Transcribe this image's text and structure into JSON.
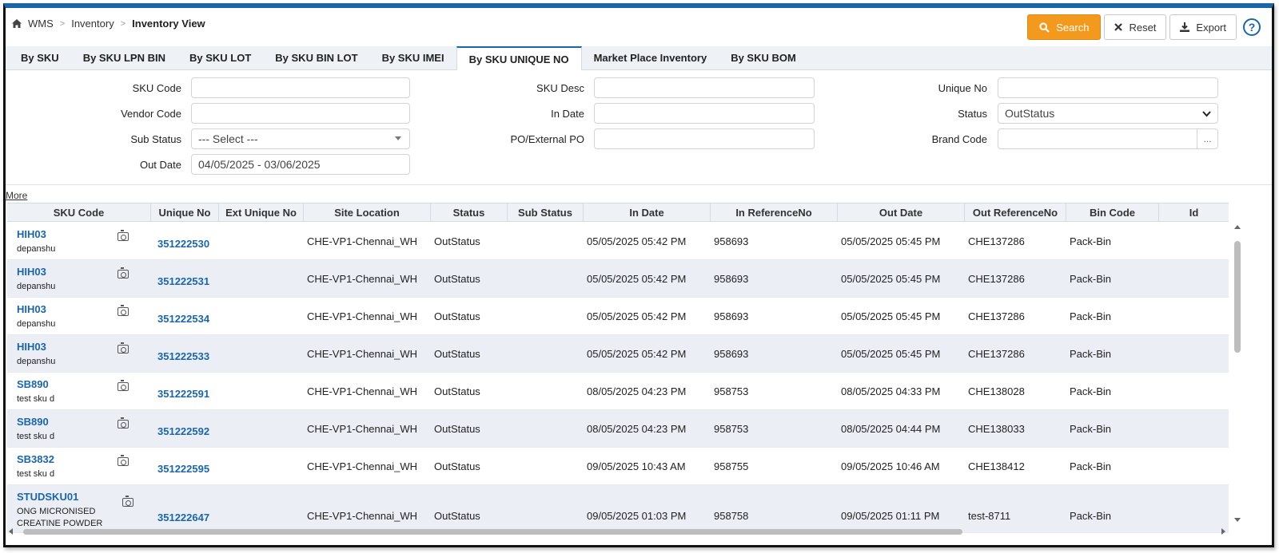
{
  "breadcrumb": {
    "home_icon": "home-icon",
    "items": [
      "WMS",
      "Inventory",
      "Inventory View"
    ],
    "separator": ">"
  },
  "toolbar": {
    "search_label": "Search",
    "reset_label": "Reset",
    "export_label": "Export",
    "help_label": "?",
    "accent_color": "#f39a1e"
  },
  "tabs": [
    {
      "label": "By SKU",
      "active": false
    },
    {
      "label": "By SKU LPN BIN",
      "active": false
    },
    {
      "label": "By SKU LOT",
      "active": false
    },
    {
      "label": "By SKU BIN LOT",
      "active": false
    },
    {
      "label": "By SKU IMEI",
      "active": false
    },
    {
      "label": "By SKU UNIQUE NO",
      "active": true
    },
    {
      "label": "Market Place Inventory",
      "active": false
    },
    {
      "label": "By SKU BOM",
      "active": false
    }
  ],
  "filters": {
    "sku_code": {
      "label": "SKU Code",
      "value": ""
    },
    "sku_desc": {
      "label": "SKU Desc",
      "value": ""
    },
    "unique_no": {
      "label": "Unique No",
      "value": ""
    },
    "vendor_code": {
      "label": "Vendor Code",
      "value": ""
    },
    "in_date": {
      "label": "In Date",
      "value": ""
    },
    "status": {
      "label": "Status",
      "value": "OutStatus"
    },
    "sub_status": {
      "label": "Sub Status",
      "value": "--- Select ---"
    },
    "po_external": {
      "label": "PO/External PO",
      "value": ""
    },
    "brand_code": {
      "label": "Brand Code",
      "value": "",
      "lookup": "..."
    },
    "out_date": {
      "label": "Out Date",
      "value": "04/05/2025 - 03/06/2025"
    }
  },
  "more_link": "More",
  "grid": {
    "columns": [
      "SKU Code",
      "Unique No",
      "Ext Unique No",
      "Site Location",
      "Status",
      "Sub Status",
      "In Date",
      "In ReferenceNo",
      "Out Date",
      "Out ReferenceNo",
      "Bin Code",
      "Id"
    ],
    "rows": [
      {
        "sku_code": "HIH03",
        "sku_desc": "depanshu",
        "unique_no": "351222530",
        "ext_unique_no": "",
        "site_location": "CHE-VP1-Chennai_WH",
        "status": "OutStatus",
        "sub_status": "",
        "in_date": "05/05/2025 05:42 PM",
        "in_ref": "958693",
        "out_date": "05/05/2025 05:45 PM",
        "out_ref": "CHE137286",
        "bin_code": "Pack-Bin",
        "id": ""
      },
      {
        "sku_code": "HIH03",
        "sku_desc": "depanshu",
        "unique_no": "351222531",
        "ext_unique_no": "",
        "site_location": "CHE-VP1-Chennai_WH",
        "status": "OutStatus",
        "sub_status": "",
        "in_date": "05/05/2025 05:42 PM",
        "in_ref": "958693",
        "out_date": "05/05/2025 05:45 PM",
        "out_ref": "CHE137286",
        "bin_code": "Pack-Bin",
        "id": ""
      },
      {
        "sku_code": "HIH03",
        "sku_desc": "depanshu",
        "unique_no": "351222534",
        "ext_unique_no": "",
        "site_location": "CHE-VP1-Chennai_WH",
        "status": "OutStatus",
        "sub_status": "",
        "in_date": "05/05/2025 05:42 PM",
        "in_ref": "958693",
        "out_date": "05/05/2025 05:45 PM",
        "out_ref": "CHE137286",
        "bin_code": "Pack-Bin",
        "id": ""
      },
      {
        "sku_code": "HIH03",
        "sku_desc": "depanshu",
        "unique_no": "351222533",
        "ext_unique_no": "",
        "site_location": "CHE-VP1-Chennai_WH",
        "status": "OutStatus",
        "sub_status": "",
        "in_date": "05/05/2025 05:42 PM",
        "in_ref": "958693",
        "out_date": "05/05/2025 05:45 PM",
        "out_ref": "CHE137286",
        "bin_code": "Pack-Bin",
        "id": ""
      },
      {
        "sku_code": "SB890",
        "sku_desc": "test sku d",
        "unique_no": "351222591",
        "ext_unique_no": "",
        "site_location": "CHE-VP1-Chennai_WH",
        "status": "OutStatus",
        "sub_status": "",
        "in_date": "08/05/2025 04:23 PM",
        "in_ref": "958753",
        "out_date": "08/05/2025 04:33 PM",
        "out_ref": "CHE138028",
        "bin_code": "Pack-Bin",
        "id": ""
      },
      {
        "sku_code": "SB890",
        "sku_desc": "test sku d",
        "unique_no": "351222592",
        "ext_unique_no": "",
        "site_location": "CHE-VP1-Chennai_WH",
        "status": "OutStatus",
        "sub_status": "",
        "in_date": "08/05/2025 04:23 PM",
        "in_ref": "958753",
        "out_date": "08/05/2025 04:44 PM",
        "out_ref": "CHE138033",
        "bin_code": "Pack-Bin",
        "id": ""
      },
      {
        "sku_code": "SB3832",
        "sku_desc": "test sku d",
        "unique_no": "351222595",
        "ext_unique_no": "",
        "site_location": "CHE-VP1-Chennai_WH",
        "status": "OutStatus",
        "sub_status": "",
        "in_date": "09/05/2025 10:43 AM",
        "in_ref": "958755",
        "out_date": "09/05/2025 10:46 AM",
        "out_ref": "CHE138412",
        "bin_code": "Pack-Bin",
        "id": ""
      },
      {
        "sku_code": "STUDSKU01",
        "sku_desc": "ONG MICRONISED CREATINE POWDER",
        "unique_no": "351222647",
        "ext_unique_no": "",
        "site_location": "CHE-VP1-Chennai_WH",
        "status": "OutStatus",
        "sub_status": "",
        "in_date": "09/05/2025 01:03 PM",
        "in_ref": "958758",
        "out_date": "09/05/2025 01:11 PM",
        "out_ref": "test-8711",
        "bin_code": "Pack-Bin",
        "id": ""
      }
    ]
  },
  "colors": {
    "brand": "#1b66a8",
    "header_bg": "#eef1f6",
    "alt_row": "#ebeef5"
  }
}
